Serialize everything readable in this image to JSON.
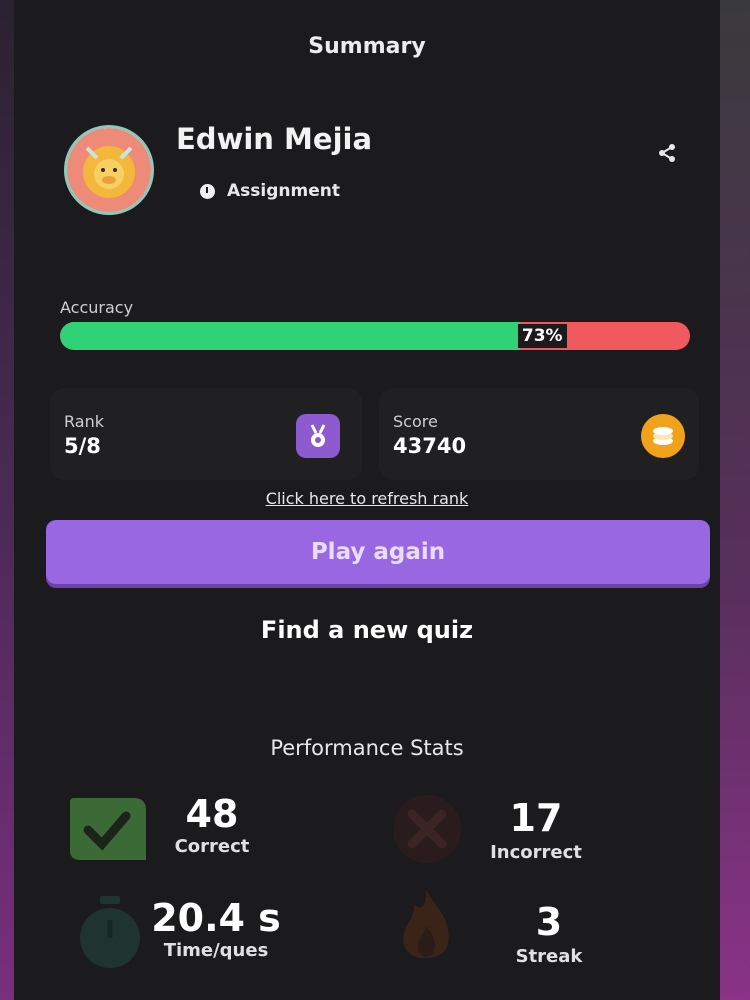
{
  "header": {
    "title": "Summary"
  },
  "profile": {
    "name": "Edwin Mejia",
    "mode": "Assignment",
    "avatar_icon": "lion-avatar-icon",
    "share_icon": "share-icon"
  },
  "accuracy": {
    "label": "Accuracy",
    "percent_text": "73%",
    "value": 73,
    "correct_color": "#2fd275",
    "incorrect_color": "#f05a5f"
  },
  "rank": {
    "label": "Rank",
    "value": "5/8",
    "icon": "medal-icon",
    "icon_color": "#8e5ad0"
  },
  "score": {
    "label": "Score",
    "value": "43740",
    "icon": "coins-icon",
    "icon_color": "#f0a21a"
  },
  "actions": {
    "refresh_rank": "Click here to refresh rank",
    "play_again": "Play again",
    "find_new_quiz": "Find a new quiz",
    "accent_color": "#9a67e3"
  },
  "performance": {
    "title": "Performance Stats",
    "correct": {
      "value": "48",
      "label": "Correct",
      "icon": "checkmark-icon"
    },
    "incorrect": {
      "value": "17",
      "label": "Incorrect",
      "icon": "cross-icon"
    },
    "time": {
      "value": "20.4 s",
      "label": "Time/ques",
      "icon": "stopwatch-icon"
    },
    "streak": {
      "value": "3",
      "label": "Streak",
      "icon": "flame-icon"
    }
  }
}
